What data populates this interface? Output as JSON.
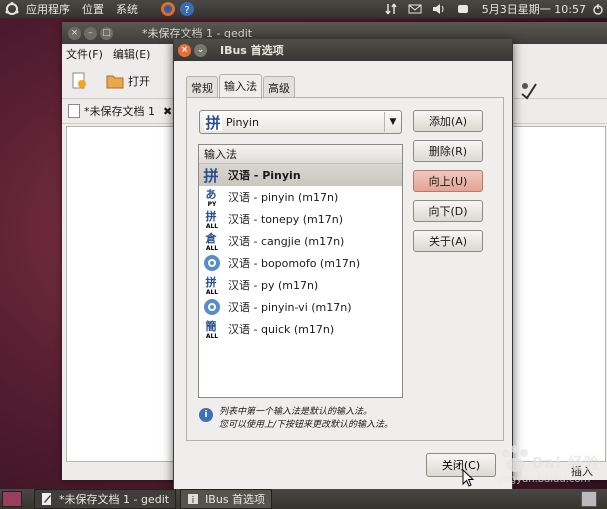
{
  "top_panel": {
    "menus": [
      "应用程序",
      "位置",
      "系统"
    ],
    "clock": "5月3日星期一 10:57"
  },
  "gedit": {
    "title": "*未保存文档 1 - gedit",
    "menus": [
      "文件(F)",
      "编辑(E)"
    ],
    "open_label": "打开",
    "tab_label": "*未保存文档 1",
    "status_insert": "插入"
  },
  "ibus": {
    "title": "IBus 首选项",
    "tabs": [
      "常规",
      "输入法",
      "高级"
    ],
    "combo_value": "Pinyin",
    "list_header": "输入法",
    "engines": [
      {
        "label": "汉语 - Pinyin",
        "icon": "pinyin-icon",
        "selected": true
      },
      {
        "label": "汉语 - pinyin (m17n)",
        "icon": "py-icon",
        "selected": false
      },
      {
        "label": "汉语 - tonepy (m17n)",
        "icon": "tonepy-icon",
        "selected": false
      },
      {
        "label": "汉语 - cangjie (m17n)",
        "icon": "cangjie-icon",
        "selected": false
      },
      {
        "label": "汉语 - bopomofo (m17n)",
        "icon": "gear-icon",
        "selected": false
      },
      {
        "label": "汉语 - py (m17n)",
        "icon": "py-all-icon",
        "selected": false
      },
      {
        "label": "汉语 - pinyin-vi (m17n)",
        "icon": "gear-icon",
        "selected": false
      },
      {
        "label": "汉语 - quick (m17n)",
        "icon": "quick-icon",
        "selected": false
      }
    ],
    "buttons": {
      "add": "添加(A)",
      "remove": "删除(R)",
      "up": "向上(U)",
      "down": "向下(D)",
      "about": "关于(A)"
    },
    "hint_line1": "列表中第一个输入法是默认的输入法。",
    "hint_line2": "您可以使用上/下按钮来更改默认的输入法。",
    "close_label": "关闭(C)"
  },
  "taskbar": {
    "items": [
      "*未保存文档 1 - gedit",
      "IBus 首选项"
    ]
  },
  "watermark": {
    "text": "Bai 经验",
    "url": "jingyan.baidu.com"
  },
  "colors": {
    "accent": "#e96f3a",
    "panel": "#3f3d39",
    "selected_row": "#cfcbc4"
  }
}
